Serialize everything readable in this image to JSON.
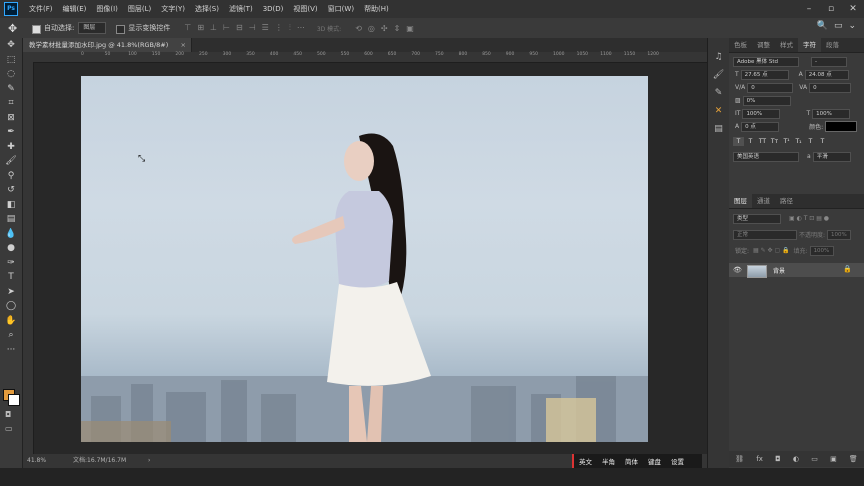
{
  "app": {
    "logo": "Ps"
  },
  "menu": [
    "文件(F)",
    "编辑(E)",
    "图像(I)",
    "图层(L)",
    "文字(Y)",
    "选择(S)",
    "滤镜(T)",
    "3D(D)",
    "视图(V)",
    "窗口(W)",
    "帮助(H)"
  ],
  "options_bar": {
    "auto_select_label": "自动选择:",
    "auto_select_value": "图层",
    "show_transform_label": "显示变换控件",
    "mode_3d_label": "3D 模式:"
  },
  "document": {
    "tab_title": "教学素材批量添加水印.jpg @ 41.8%(RGB/8#)",
    "tab_close": "×"
  },
  "ruler_ticks": [
    "0",
    "50",
    "100",
    "150",
    "200",
    "250",
    "300",
    "350",
    "400",
    "450",
    "500",
    "550",
    "600",
    "650",
    "700",
    "750",
    "800",
    "850",
    "900",
    "950",
    "1000",
    "1050",
    "1100",
    "1150",
    "1200"
  ],
  "status": {
    "zoom": "41.8%",
    "doc_info": "文档:16.7M/16.7M",
    "arrow": "›"
  },
  "ime": [
    "英文",
    "半角",
    "简体",
    "键盘",
    "设置"
  ],
  "right_icons_top": [
    "🔍",
    "▭",
    "⌄"
  ],
  "char_panel": {
    "tabs": [
      "色板",
      "调整",
      "样式",
      "字符",
      "段落"
    ],
    "active_tab": "字符",
    "font_family": "Adobe 黑体 Std",
    "font_style": "-",
    "font_size": "27.65 点",
    "leading": "24.08 点",
    "kerning": "0",
    "tracking": "0",
    "tsume": "0%",
    "vscale": "100%",
    "hscale": "100%",
    "baseline": "0 点",
    "color_label": "颜色:",
    "color": "#000000",
    "style_buttons": [
      "T",
      "T",
      "TT",
      "Tт",
      "T¹",
      "T₁",
      "T",
      "T"
    ],
    "language": "美国英语",
    "antialias": "a",
    "antialias_mode": "平滑"
  },
  "layers_panel": {
    "tabs": [
      "图层",
      "通道",
      "路径"
    ],
    "active_tab": "图层",
    "filter_label": "类型",
    "blend_mode": "正常",
    "opacity_label": "不透明度:",
    "opacity": "100%",
    "lock_label": "锁定:",
    "fill_label": "填充:",
    "fill": "100%",
    "layer_name": "背景",
    "footer_icons": [
      "⛓",
      "fx",
      "◘",
      "◐",
      "▭",
      "▣",
      "🗑"
    ]
  }
}
